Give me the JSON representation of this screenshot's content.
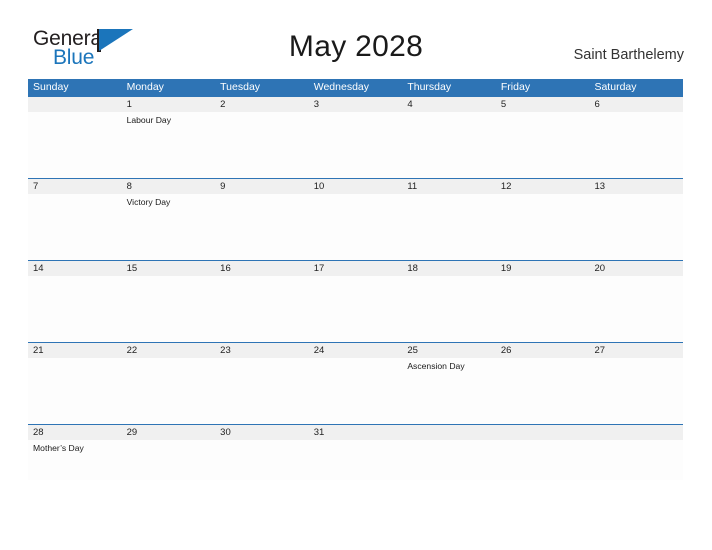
{
  "brand": {
    "name_part1": "General",
    "name_part2": "Blue",
    "color_dark": "#231f20",
    "color_blue": "#1b75bb"
  },
  "header": {
    "title": "May 2028",
    "location": "Saint Barthelemy"
  },
  "theme": {
    "header_blue": "#2e74b5",
    "date_band": "#f0f0f0",
    "cell_background": "#fdfdfd"
  },
  "calendar": {
    "weekdays": [
      "Sunday",
      "Monday",
      "Tuesday",
      "Wednesday",
      "Thursday",
      "Friday",
      "Saturday"
    ],
    "weeks": [
      {
        "days": [
          {
            "date": "",
            "events": []
          },
          {
            "date": "1",
            "events": [
              "Labour Day"
            ]
          },
          {
            "date": "2",
            "events": []
          },
          {
            "date": "3",
            "events": []
          },
          {
            "date": "4",
            "events": []
          },
          {
            "date": "5",
            "events": []
          },
          {
            "date": "6",
            "events": []
          }
        ]
      },
      {
        "days": [
          {
            "date": "7",
            "events": []
          },
          {
            "date": "8",
            "events": [
              "Victory Day"
            ]
          },
          {
            "date": "9",
            "events": []
          },
          {
            "date": "10",
            "events": []
          },
          {
            "date": "11",
            "events": []
          },
          {
            "date": "12",
            "events": []
          },
          {
            "date": "13",
            "events": []
          }
        ]
      },
      {
        "days": [
          {
            "date": "14",
            "events": []
          },
          {
            "date": "15",
            "events": []
          },
          {
            "date": "16",
            "events": []
          },
          {
            "date": "17",
            "events": []
          },
          {
            "date": "18",
            "events": []
          },
          {
            "date": "19",
            "events": []
          },
          {
            "date": "20",
            "events": []
          }
        ]
      },
      {
        "days": [
          {
            "date": "21",
            "events": []
          },
          {
            "date": "22",
            "events": []
          },
          {
            "date": "23",
            "events": []
          },
          {
            "date": "24",
            "events": []
          },
          {
            "date": "25",
            "events": [
              "Ascension Day"
            ]
          },
          {
            "date": "26",
            "events": []
          },
          {
            "date": "27",
            "events": []
          }
        ]
      },
      {
        "days": [
          {
            "date": "28",
            "events": [
              "Mother’s Day"
            ]
          },
          {
            "date": "29",
            "events": []
          },
          {
            "date": "30",
            "events": []
          },
          {
            "date": "31",
            "events": []
          },
          {
            "date": "",
            "events": []
          },
          {
            "date": "",
            "events": []
          },
          {
            "date": "",
            "events": []
          }
        ]
      }
    ]
  }
}
